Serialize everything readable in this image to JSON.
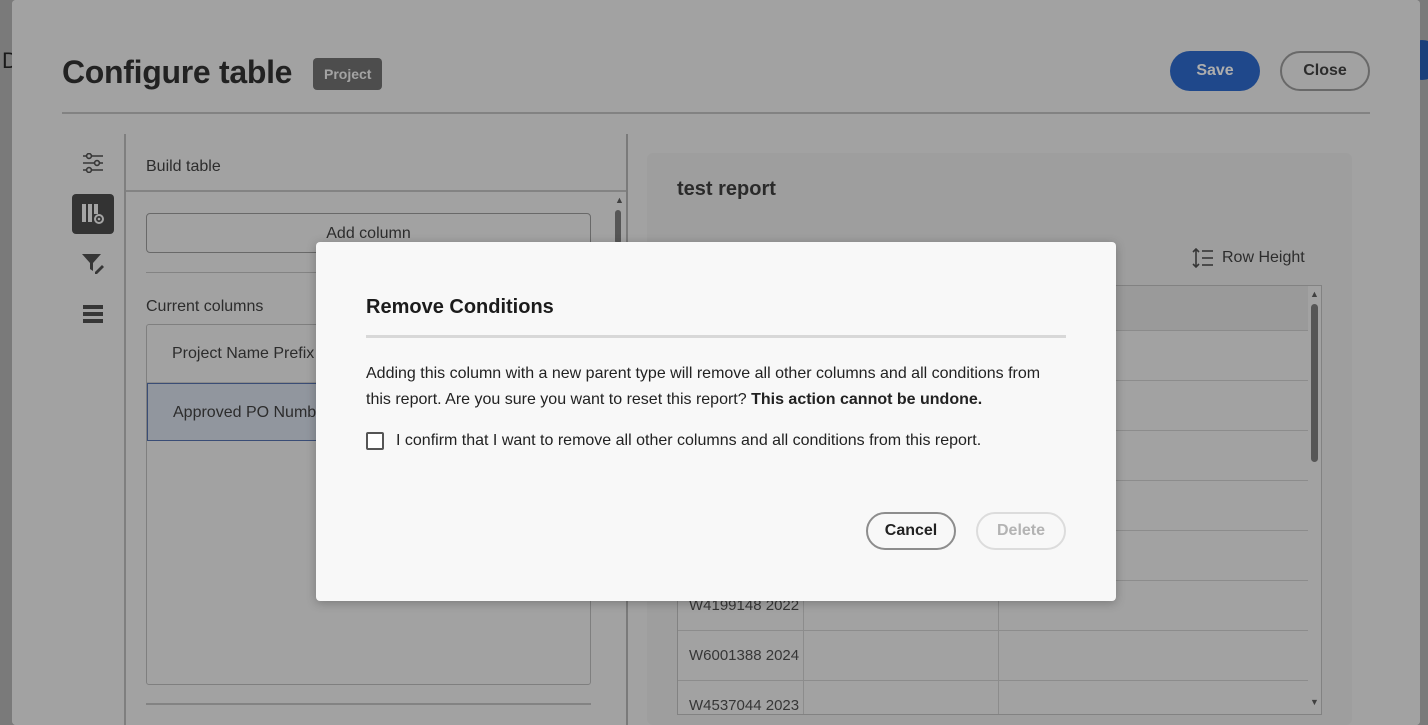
{
  "background": {
    "partial_letter": "D"
  },
  "header": {
    "title": "Configure table",
    "tag": "Project",
    "save_label": "Save",
    "close_label": "Close"
  },
  "rail": {
    "icons": [
      "sliders-icon",
      "table-settings-icon",
      "filter-edit-icon",
      "list-rows-icon"
    ],
    "active_index": 1
  },
  "build": {
    "heading": "Build table",
    "add_column_label": "Add column",
    "current_columns_label": "Current columns",
    "columns": [
      "Project Name Prefix",
      "Approved PO Numb"
    ]
  },
  "report": {
    "title": "test report",
    "row_height_label": "Row Height",
    "rows": [
      "",
      "",
      "",
      "",
      "",
      "W4199148 2022",
      "W6001388 2024",
      "W4537044 2023"
    ]
  },
  "modal": {
    "title": "Remove Conditions",
    "body_text": "Adding this column with a new parent type will remove all other columns and all conditions from this report. Are you sure you want to reset this report?",
    "body_bold": "This action cannot be undone.",
    "confirm_label": "I confirm that I want to remove all other columns and all conditions from this report.",
    "cancel_label": "Cancel",
    "delete_label": "Delete"
  },
  "colors": {
    "accent": "#0b52c5",
    "modal_bg": "#f8f8f8",
    "overlay": "#7a7a7a"
  }
}
